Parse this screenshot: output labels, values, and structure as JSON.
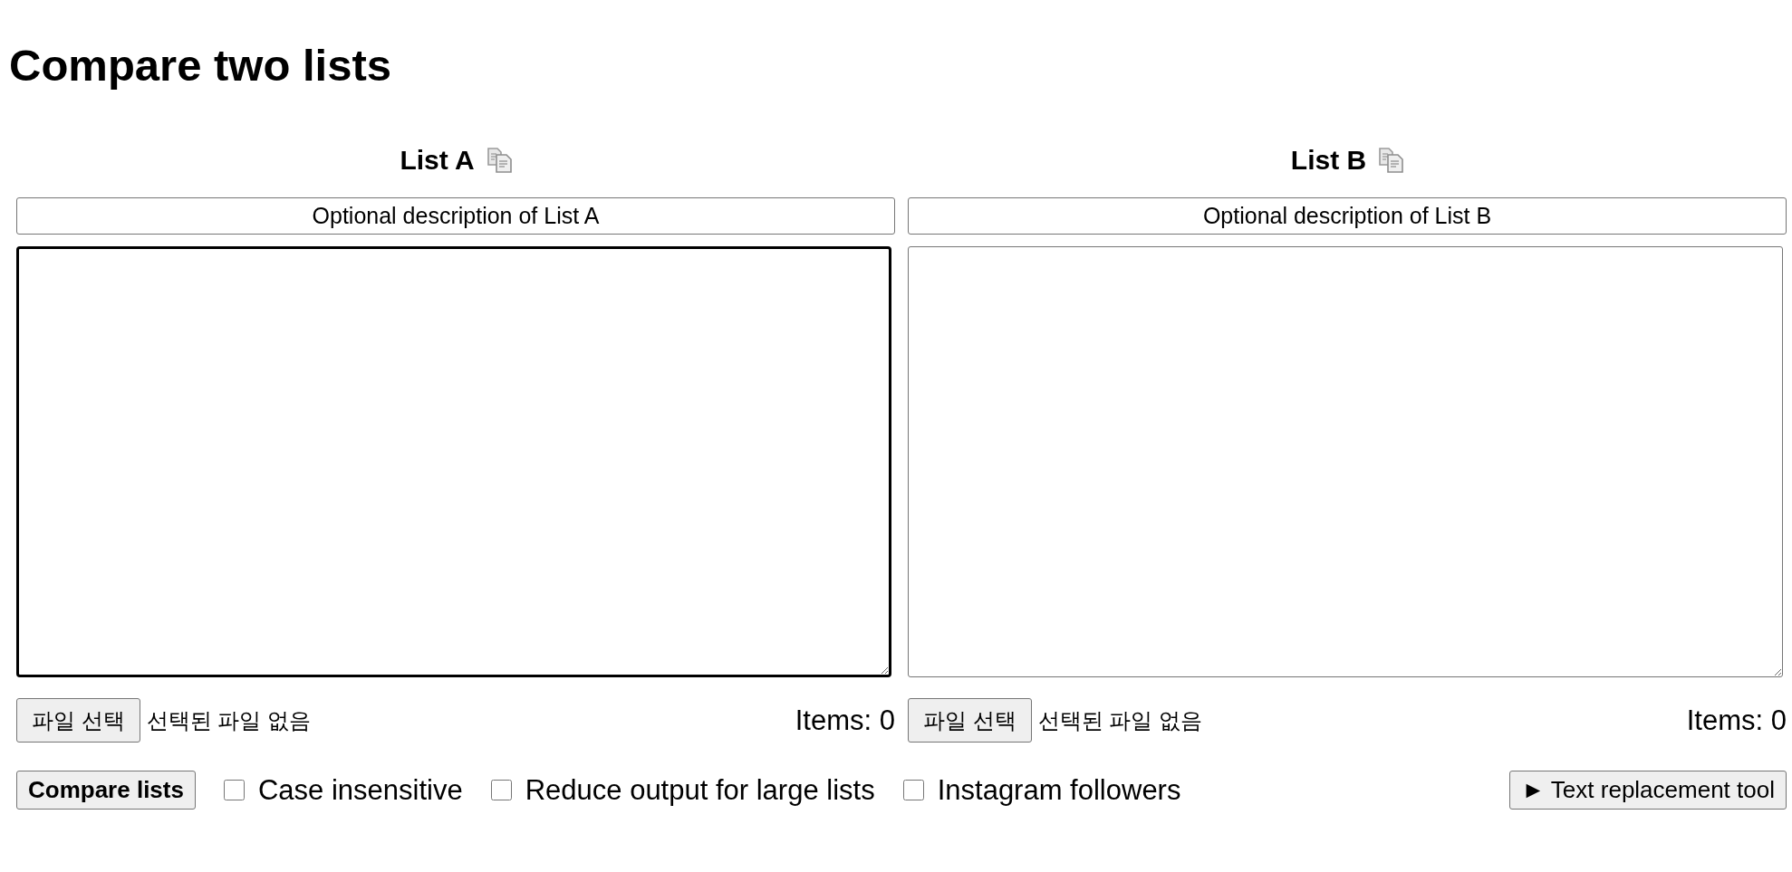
{
  "title": "Compare two lists",
  "lists": [
    {
      "heading": "List A",
      "description": "Optional description of List A",
      "focused": true,
      "file_button": "파일 선택",
      "file_status": "선택된 파일 없음",
      "item_count": "Items: 0"
    },
    {
      "heading": "List B",
      "description": "Optional description of List B",
      "focused": false,
      "file_button": "파일 선택",
      "file_status": "선택된 파일 없음",
      "item_count": "Items: 0"
    }
  ],
  "actions": {
    "compare_button": "Compare lists",
    "options": [
      {
        "label": "Case insensitive",
        "checked": false
      },
      {
        "label": "Reduce output for large lists",
        "checked": false
      },
      {
        "label": "Instagram followers",
        "checked": false
      }
    ],
    "tool_button": "► Text replacement tool"
  }
}
